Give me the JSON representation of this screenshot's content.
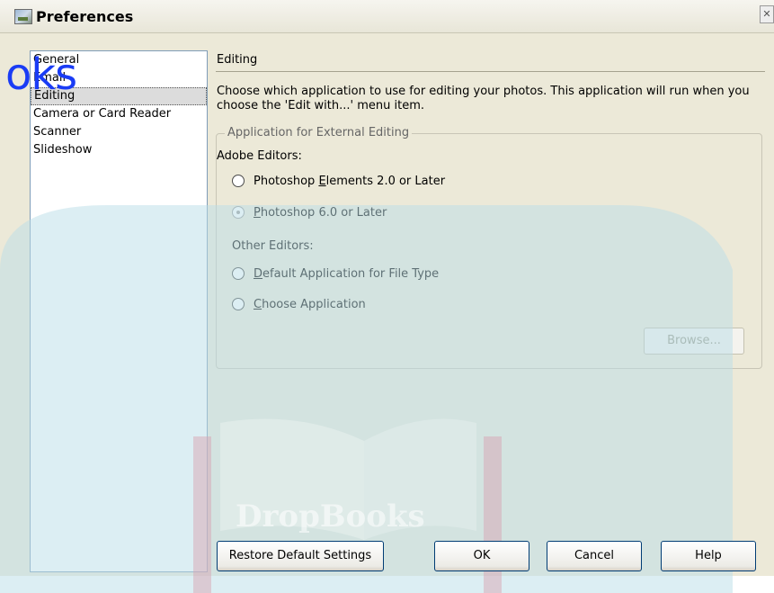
{
  "window": {
    "title": "Preferences",
    "close_glyph": "✕"
  },
  "sidebar": {
    "items": [
      {
        "label": "General"
      },
      {
        "label": "Email"
      },
      {
        "label": "Editing",
        "selected": true
      },
      {
        "label": "Camera or Card Reader"
      },
      {
        "label": "Scanner"
      },
      {
        "label": "Slideshow"
      }
    ],
    "overlay_text": "oks"
  },
  "editing": {
    "header": "Editing",
    "description": "Choose which application to use for editing your photos. This application will run when you choose the 'Edit with...' menu item.",
    "group_title": "Application for External Editing",
    "adobe_label": "Adobe Editors:",
    "other_label": "Other Editors:",
    "options": [
      {
        "pre": "Photoshop ",
        "accel": "E",
        "post": "lements 2.0 or Later",
        "checked": false,
        "enabled": true
      },
      {
        "pre": "",
        "accel": "P",
        "post": "hotoshop 6.0 or Later",
        "checked": true,
        "enabled": false
      },
      {
        "pre": "",
        "accel": "D",
        "post": "efault Application for File Type",
        "checked": false,
        "enabled": true
      },
      {
        "pre": "",
        "accel": "C",
        "post": "hoose Application",
        "checked": false,
        "enabled": true
      }
    ],
    "browse_label": "Browse..."
  },
  "footer": {
    "restore_label": "Restore Default Settings",
    "ok_label": "OK",
    "cancel_label": "Cancel",
    "help_label": "Help"
  },
  "watermark": {
    "brand": "DropBooks"
  },
  "colors": {
    "dialog_bg": "#ece9d8",
    "list_border": "#7f9db9",
    "watermark_cyan": "#c8e6ee",
    "watermark_pink": "#d8a6b4",
    "overlay_blue": "#1a3cf5"
  }
}
